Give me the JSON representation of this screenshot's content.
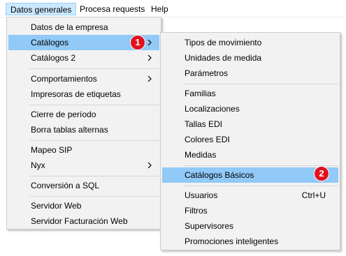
{
  "menubar": {
    "items": [
      {
        "label": "Datos generales"
      },
      {
        "label": "Procesa requests"
      },
      {
        "label": "Help"
      }
    ]
  },
  "main_menu": {
    "items": [
      {
        "label": "Datos de la empresa"
      },
      {
        "label": "Catálogos"
      },
      {
        "label": "Catálogos 2"
      },
      {
        "label": "Comportamientos"
      },
      {
        "label": "Impresoras de etiquetas"
      },
      {
        "label": "Cierre de período"
      },
      {
        "label": "Borra tablas alternas"
      },
      {
        "label": "Mapeo SIP"
      },
      {
        "label": "Nyx"
      },
      {
        "label": "Conversión a SQL"
      },
      {
        "label": "Servidor Web"
      },
      {
        "label": "Servidor Facturación Web"
      }
    ]
  },
  "submenu": {
    "items": [
      {
        "label": "Tipos de movimiento"
      },
      {
        "label": "Unidades de medida"
      },
      {
        "label": "Parámetros"
      },
      {
        "label": "Familias"
      },
      {
        "label": "Localizaciones"
      },
      {
        "label": "Tallas EDI"
      },
      {
        "label": "Colores EDI"
      },
      {
        "label": "Medidas"
      },
      {
        "label": "Catálogos Básicos"
      },
      {
        "label": "Usuarios",
        "shortcut": "Ctrl+U"
      },
      {
        "label": "Filtros"
      },
      {
        "label": "Supervisores"
      },
      {
        "label": "Promociones inteligentes"
      }
    ]
  },
  "badges": [
    "1",
    "2"
  ],
  "colors": {
    "highlight": "#91c9f7",
    "menubar_active": "#cce8ff",
    "badge": "#e0121d"
  }
}
